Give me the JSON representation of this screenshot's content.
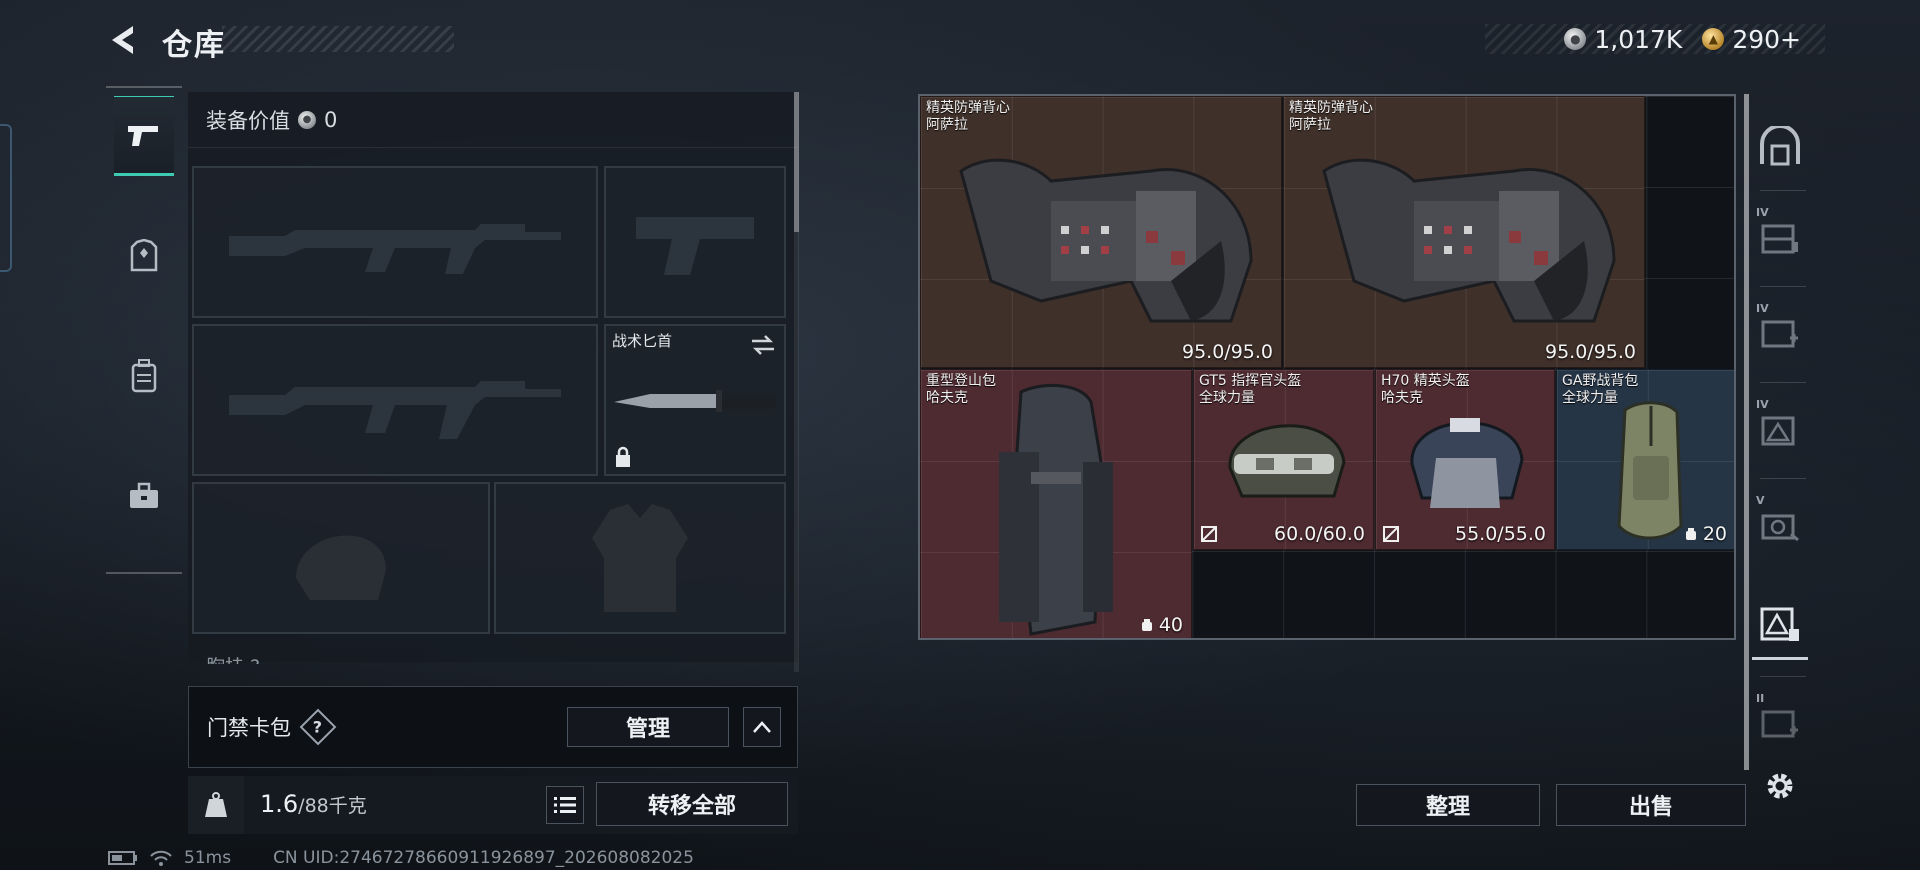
{
  "header": {
    "title": "仓库",
    "back_icon": "back-arrow-icon",
    "currency": [
      {
        "icon": "silver-coin-icon",
        "value": "1,017K"
      },
      {
        "icon": "gold-coin-icon",
        "value": "290+"
      }
    ]
  },
  "left_tabs": [
    {
      "name": "weapons",
      "icon": "pistol-icon",
      "active": true
    },
    {
      "name": "gear",
      "icon": "armor-icon",
      "active": false
    },
    {
      "name": "backpack",
      "icon": "backpack-icon",
      "active": false
    },
    {
      "name": "kit",
      "icon": "toolbox-icon",
      "active": false
    }
  ],
  "equipment": {
    "value_label": "装备价值",
    "value": "0",
    "slots": [
      {
        "kind": "primary-rifle",
        "label": ""
      },
      {
        "kind": "pistol",
        "label": ""
      },
      {
        "kind": "secondary-rifle",
        "label": ""
      },
      {
        "kind": "melee",
        "label": "战术匕首",
        "locked": true,
        "swap_icon": "swap-icon"
      },
      {
        "kind": "helmet",
        "label": ""
      },
      {
        "kind": "armor",
        "label": ""
      }
    ],
    "partial_row_label": "胸挂 ?"
  },
  "keycard": {
    "label": "门禁卡包",
    "help": "?",
    "manage_label": "管理",
    "collapse_icon": "chevron-up-icon"
  },
  "bottom": {
    "weight_value": "1.6",
    "weight_suffix": "/88千克",
    "transfer_all_label": "转移全部"
  },
  "status": {
    "ping": "51ms",
    "uid": "CN UID:2746727866091192689​7_202608082025"
  },
  "storage": {
    "items": [
      {
        "name1": "精英防弹背心",
        "name2": "阿萨拉",
        "stat": "95.0/95.0",
        "color": "#40302a",
        "icon": "vest-icon"
      },
      {
        "name1": "精英防弹背心",
        "name2": "阿萨拉",
        "stat": "95.0/95.0",
        "color": "#40302a",
        "icon": "vest-icon"
      },
      {
        "name1": "重型登山包",
        "name2": "哈夫克",
        "stat": "40",
        "color": "#4e2a31",
        "icon": "backpack-icon"
      },
      {
        "name1": "GT5 指挥官头盔",
        "name2": "全球力量",
        "stat": "60.0/60.0",
        "color": "#4e2a31",
        "icon": "helmet-icon"
      },
      {
        "name1": "H70 精英头盔",
        "name2": "哈夫克",
        "stat": "55.0/55.0",
        "color": "#4e2a31",
        "icon": "helmet-icon"
      },
      {
        "name1": "GA野战背包",
        "name2": "全球力量",
        "stat": "20",
        "color": "#253546",
        "icon": "bag-icon"
      }
    ],
    "sort_label": "整理",
    "sell_label": "出售"
  },
  "right_rail": [
    {
      "icon": "storage-arch-icon",
      "tier": ""
    },
    {
      "icon": "storage-shelf-icon",
      "tier": "IV"
    },
    {
      "icon": "storage-medkit-icon",
      "tier": "IV"
    },
    {
      "icon": "storage-warning-icon",
      "tier": "IV"
    },
    {
      "icon": "storage-camera-icon",
      "tier": "V"
    },
    {
      "icon": "storage-armor-icon",
      "tier": "",
      "active": true
    },
    {
      "icon": "storage-add-icon",
      "tier": "II"
    },
    {
      "icon": "gear-icon",
      "tier": ""
    }
  ]
}
